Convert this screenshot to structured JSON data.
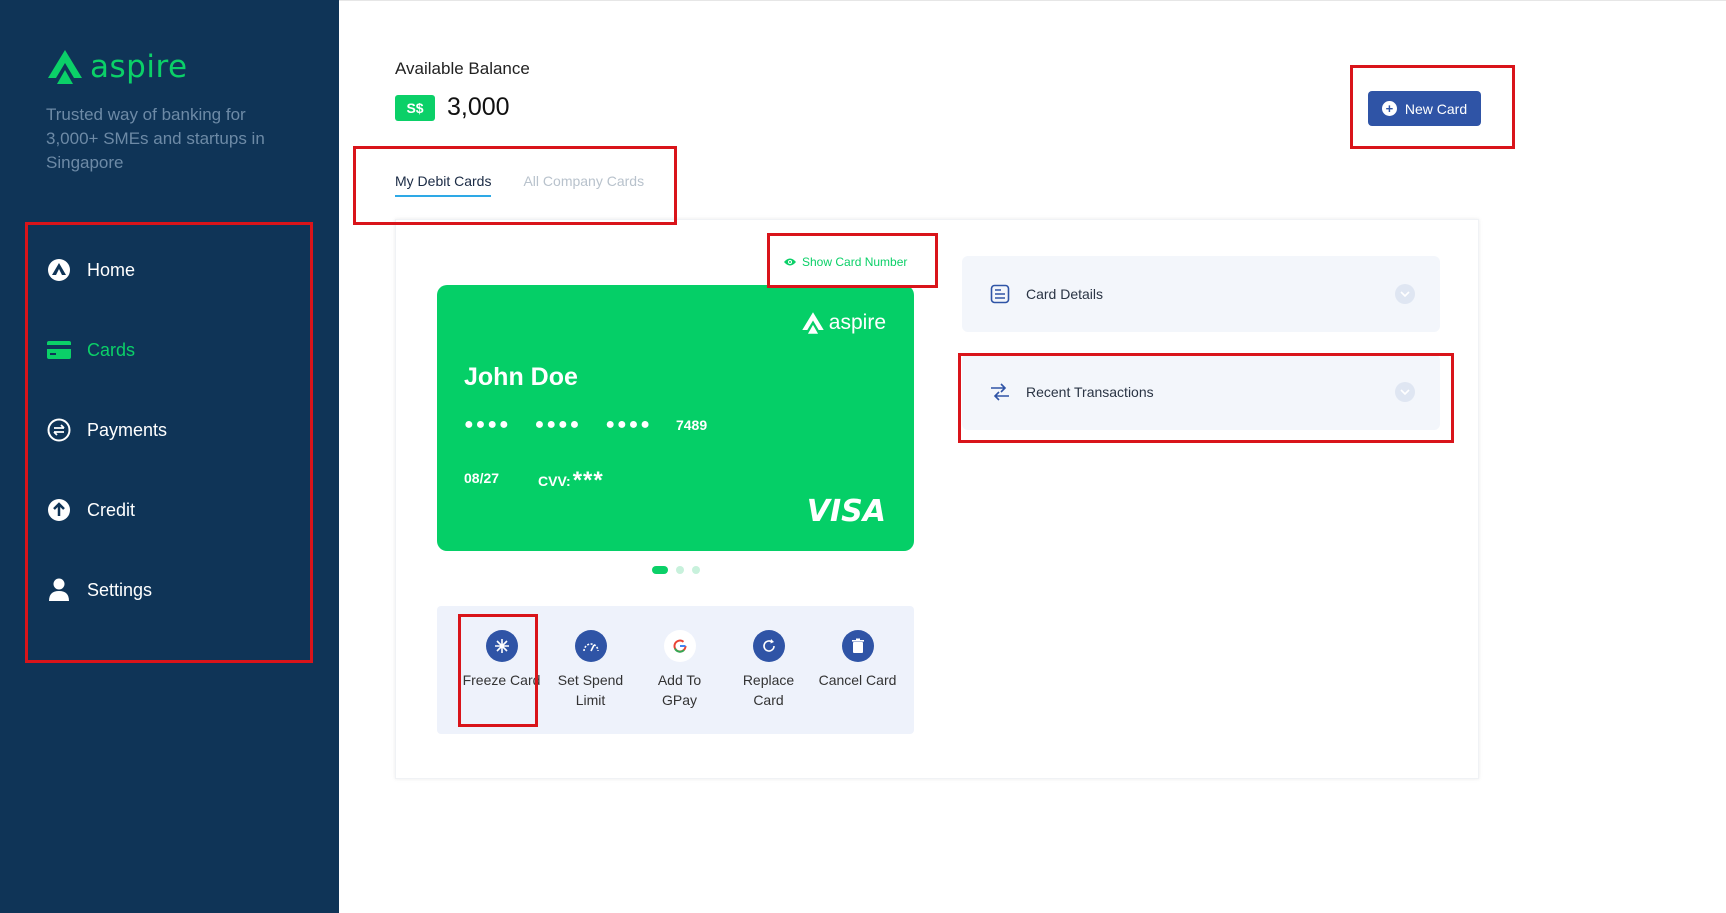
{
  "brand": {
    "name": "aspire",
    "tagline": "Trusted way of banking for 3,000+ SMEs and startups in Singapore"
  },
  "sidebar": {
    "items": [
      {
        "label": "Home",
        "icon": "home-icon"
      },
      {
        "label": "Cards",
        "icon": "card-icon",
        "active": true
      },
      {
        "label": "Payments",
        "icon": "payments-icon"
      },
      {
        "label": "Credit",
        "icon": "credit-icon"
      },
      {
        "label": "Settings",
        "icon": "user-icon"
      }
    ]
  },
  "balance": {
    "label": "Available Balance",
    "currency": "S$",
    "amount": "3,000"
  },
  "new_card_label": "New Card",
  "tabs": [
    {
      "label": "My Debit Cards",
      "active": true
    },
    {
      "label": "All Company Cards",
      "active": false
    }
  ],
  "show_card_number": "Show Card Number",
  "card": {
    "brand": "aspire",
    "holder": "John Doe",
    "masked_groups": [
      "●●●●",
      "●●●●",
      "●●●●"
    ],
    "last4": "7489",
    "expiry": "08/27",
    "cvv_label": "CVV:",
    "cvv_masked": "***",
    "network": "VISA"
  },
  "pager": {
    "count": 3,
    "active_index": 0
  },
  "actions": [
    {
      "label": "Freeze Card",
      "icon": "freeze-icon"
    },
    {
      "label": "Set Spend Limit",
      "icon": "speedometer-icon"
    },
    {
      "label": "Add To GPay",
      "icon": "google-icon"
    },
    {
      "label": "Replace Card",
      "icon": "replace-icon"
    },
    {
      "label": "Cancel Card",
      "icon": "trash-icon"
    }
  ],
  "accordions": [
    {
      "label": "Card Details",
      "icon": "document-icon"
    },
    {
      "label": "Recent Transactions",
      "icon": "transfer-icon"
    }
  ],
  "colors": {
    "sidebar_bg": "#0f3457",
    "accent_green": "#0bd068",
    "primary_blue": "#2f54a6",
    "highlight_red": "#d9141a"
  }
}
